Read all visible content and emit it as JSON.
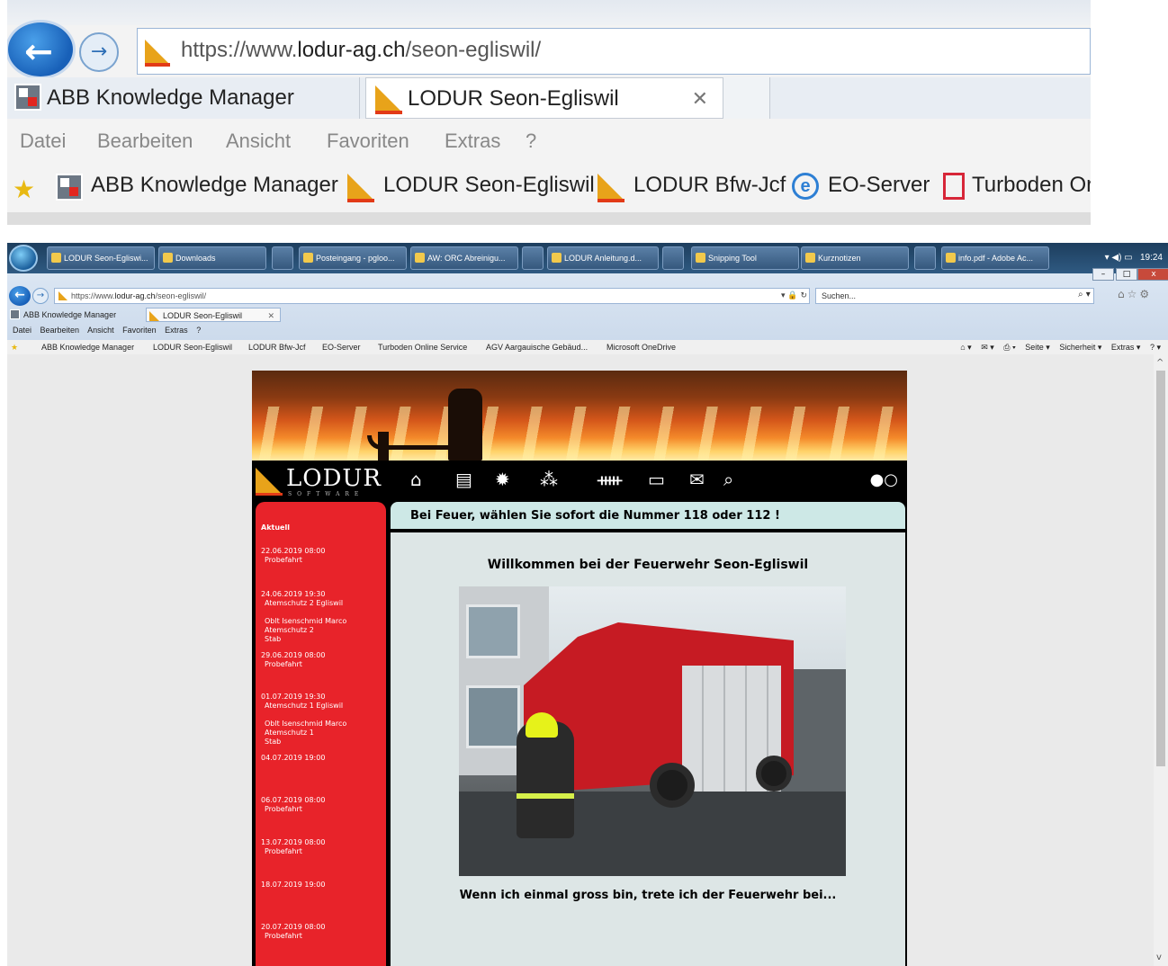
{
  "zoom": {
    "url_prefix": "https://www.",
    "url_domain": "lodur-ag.ch",
    "url_path": "/seon-egliswil/",
    "tabs": [
      {
        "label": "ABB Knowledge Manager"
      },
      {
        "label": "LODUR Seon-Egliswil",
        "close": "✕"
      }
    ],
    "menu": [
      "Datei",
      "Bearbeiten",
      "Ansicht",
      "Favoriten",
      "Extras",
      "?"
    ],
    "favorites": [
      "ABB Knowledge Manager",
      "LODUR Seon-Egliswil",
      "LODUR Bfw-Jcf",
      "EO-Server",
      "Turboden Or"
    ]
  },
  "taskbar": {
    "items": [
      "LODUR Seon-Egliswi...",
      "Downloads",
      "",
      "Posteingang - pgloo...",
      "AW: ORC Abreinigu...",
      "",
      "LODUR Anleitung.d...",
      "",
      "Snipping Tool",
      "Kurznotizen",
      "",
      "info.pdf - Adobe Ac..."
    ],
    "time": "19:24"
  },
  "browser": {
    "url_prefix": "https://www.",
    "url_domain": "lodur-ag.ch",
    "url_path": "/seon-egliswil/",
    "search_placeholder": "Suchen...",
    "tabs": [
      "ABB Knowledge Manager",
      "LODUR Seon-Egliswil"
    ],
    "menu": [
      "Datei",
      "Bearbeiten",
      "Ansicht",
      "Favoriten",
      "Extras",
      "?"
    ],
    "favorites": [
      "ABB Knowledge Manager",
      "LODUR Seon-Egliswil",
      "LODUR Bfw-Jcf",
      "EO-Server",
      "Turboden Online Service",
      "AGV Aargauische Gebäud...",
      "Microsoft OneDrive"
    ],
    "toolbar_right": [
      "Seite ▾",
      "Sicherheit ▾",
      "Extras ▾"
    ]
  },
  "site": {
    "logo": "LODUR",
    "logo_sub": "SOFTWARE",
    "toggle": "●○",
    "alert": "Bei Feuer, wählen Sie sofort die Nummer 118 oder 112 !",
    "welcome": "Willkommen bei der Feuerwehr Seon-Egliswil",
    "caption": "Wenn ich einmal gross bin, trete ich der Feuerwehr bei...",
    "sidebar_title": "Aktuell",
    "events": [
      {
        "date": "22.06.2019 08:00",
        "lines": [
          "Probefahrt"
        ]
      },
      {
        "date": "24.06.2019 19:30",
        "lines": [
          "Atemschutz 2 Egliswil",
          "",
          "Oblt Isenschmid Marco",
          "Atemschutz 2",
          "Stab"
        ]
      },
      {
        "date": "29.06.2019 08:00",
        "lines": [
          "Probefahrt"
        ]
      },
      {
        "date": "01.07.2019 19:30",
        "lines": [
          "Atemschutz 1 Egliswil",
          "",
          "Oblt Isenschmid Marco",
          "Atemschutz 1",
          "Stab"
        ]
      },
      {
        "date": "04.07.2019 19:00",
        "lines": []
      },
      {
        "date": "06.07.2019 08:00",
        "lines": [
          "Probefahrt"
        ]
      },
      {
        "date": "13.07.2019 08:00",
        "lines": [
          "Probefahrt"
        ]
      },
      {
        "date": "18.07.2019 19:00",
        "lines": []
      },
      {
        "date": "20.07.2019 08:00",
        "lines": [
          "Probefahrt"
        ]
      }
    ]
  }
}
